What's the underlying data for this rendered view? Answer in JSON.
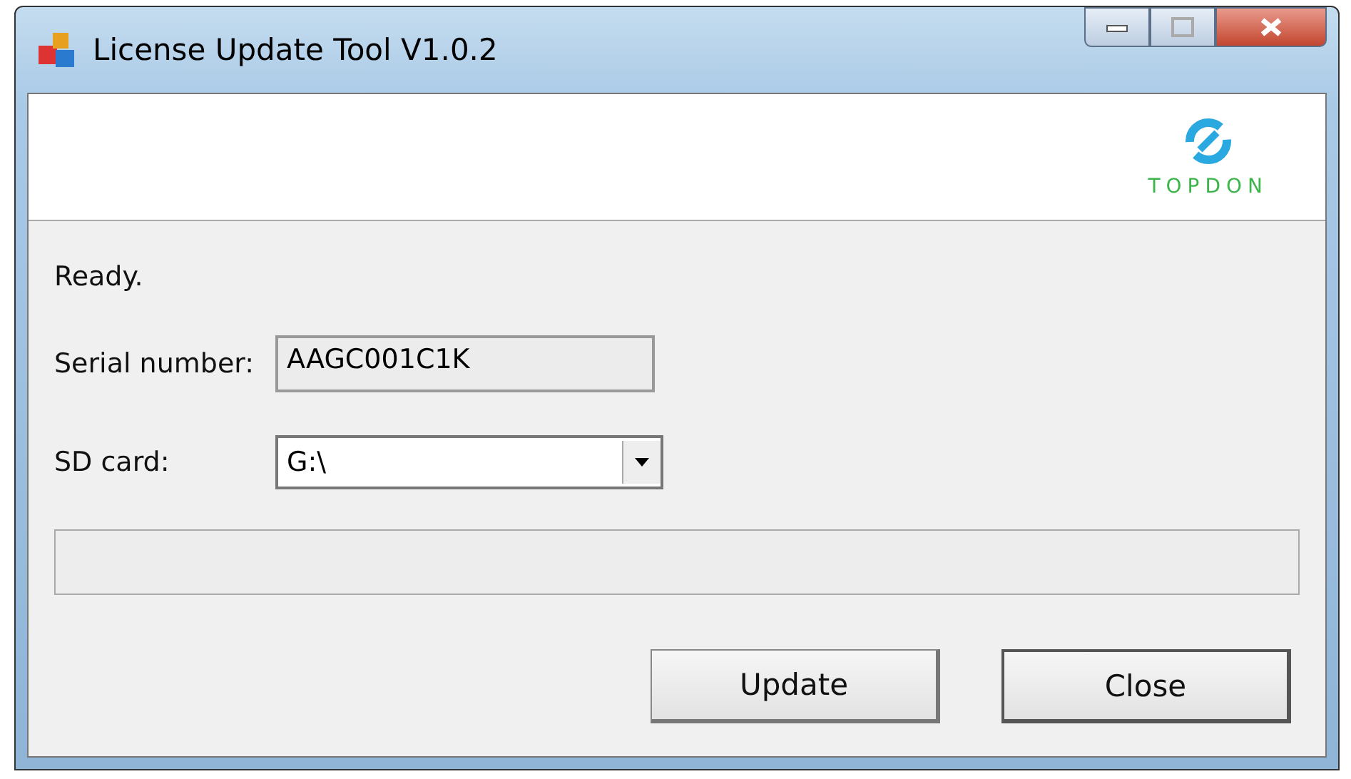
{
  "window": {
    "title": "License Update Tool V1.0.2"
  },
  "logo": {
    "text": "TOPDON"
  },
  "status": "Ready.",
  "serial": {
    "label": "Serial number:",
    "value": "AAGC001C1K"
  },
  "sd_card": {
    "label": "SD card:",
    "value": "G:\\"
  },
  "progress": {
    "level": 0
  },
  "buttons": [
    {
      "label": "Update"
    },
    {
      "label": "Close"
    }
  ]
}
